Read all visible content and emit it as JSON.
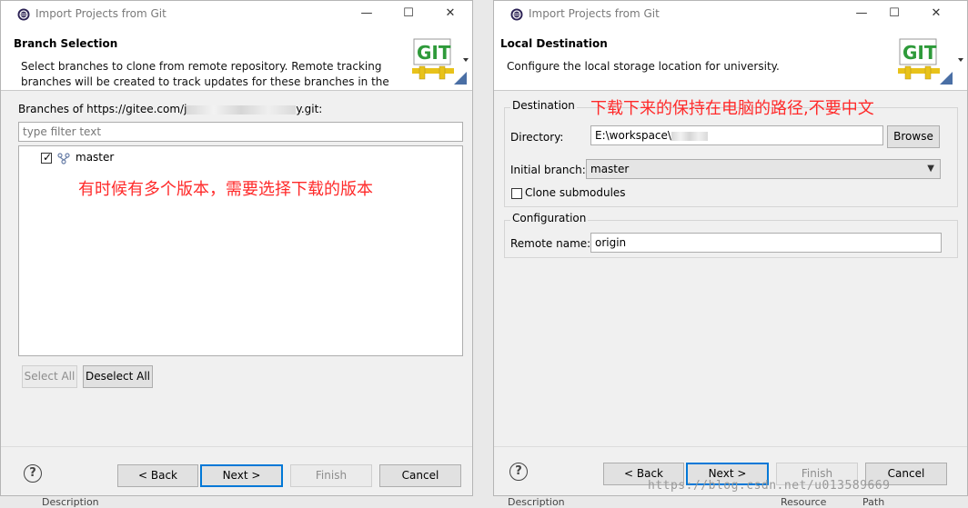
{
  "dialog_left": {
    "window_title": "Import Projects from Git",
    "window_controls": {
      "minimize": "—",
      "maximize": "☐",
      "close": "✕"
    },
    "banner": {
      "title": "Branch Selection",
      "description": "Select branches to clone from remote repository. Remote tracking branches will be created to track updates for these branches in the",
      "logo_text": "GIT"
    },
    "branches_label_prefix": "Branches of https://gitee.com/j",
    "branches_label_suffix": "y.git:",
    "filter_placeholder": "type filter text",
    "branches": [
      {
        "name": "master",
        "checked": true
      }
    ],
    "annotation": "有时候有多个版本，需要选择下载的版本",
    "select_all": "Select All",
    "deselect_all": "Deselect All",
    "buttons": {
      "back": "< Back",
      "next": "Next >",
      "finish": "Finish",
      "cancel": "Cancel"
    },
    "help": "?"
  },
  "dialog_right": {
    "window_title": "Import Projects from Git",
    "window_controls": {
      "minimize": "—",
      "maximize": "☐",
      "close": "✕"
    },
    "banner": {
      "title": "Local Destination",
      "description": "Configure the local storage location for university.",
      "logo_text": "GIT"
    },
    "destination_group": "Destination",
    "annotation": "下载下来的保持在电脑的路径,不要中文",
    "directory_label": "Directory:",
    "directory_value": "E:\\workspace\\",
    "browse": "Browse",
    "initial_branch_label": "Initial branch:",
    "initial_branch_value": "master",
    "clone_submodules": "Clone submodules",
    "configuration_group": "Configuration",
    "remote_name_label": "Remote name:",
    "remote_name_value": "origin",
    "buttons": {
      "back": "< Back",
      "next": "Next >",
      "finish": "Finish",
      "cancel": "Cancel"
    },
    "help": "?"
  },
  "background": {
    "left_fragment": "Description",
    "right_fragments": [
      "Description",
      "Resource",
      "Path"
    ]
  },
  "watermark": "https://blog.csdn.net/u013589669",
  "colors": {
    "accent_border": "#0078d7",
    "annotation": "#ff2a2a",
    "git_green": "#2e9a3a",
    "git_red": "#c8102e",
    "git_pipe": "#e8c21a"
  }
}
